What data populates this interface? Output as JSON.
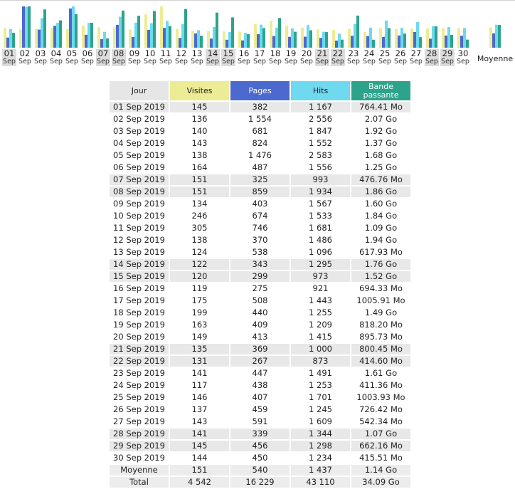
{
  "header": {
    "day_col": "Jour",
    "visits_col": "Visites",
    "pages_col": "Pages",
    "hits_col": "Hits",
    "bandwidth_col_line1": "Bande",
    "bandwidth_col_line2": "passante"
  },
  "colors": {
    "visits": "#ecec95",
    "pages": "#4b69cf",
    "hits": "#6ed9ef",
    "bandwidth": "#2ea38b",
    "weekend_bg": "#e8e8e8"
  },
  "average_label": "Moyenne",
  "chart_data": {
    "type": "bar",
    "categories": [
      "01",
      "02",
      "03",
      "04",
      "05",
      "06",
      "07",
      "08",
      "09",
      "10",
      "11",
      "12",
      "13",
      "14",
      "15",
      "16",
      "17",
      "18",
      "19",
      "20",
      "21",
      "22",
      "23",
      "24",
      "25",
      "26",
      "27",
      "28",
      "29",
      "30"
    ],
    "category_sublabel": "Sep",
    "weekend_days": [
      "01",
      "07",
      "08",
      "14",
      "15",
      "21",
      "22",
      "28",
      "29"
    ],
    "series": [
      {
        "name": "Visites",
        "values": [
          145,
          136,
          140,
          143,
          138,
          164,
          151,
          151,
          134,
          246,
          305,
          138,
          124,
          122,
          120,
          119,
          175,
          199,
          163,
          149,
          135,
          131,
          141,
          117,
          146,
          137,
          143,
          141,
          145,
          144
        ]
      },
      {
        "name": "Pages",
        "values": [
          382,
          1554,
          681,
          824,
          1476,
          487,
          325,
          859,
          403,
          674,
          746,
          370,
          538,
          343,
          299,
          275,
          508,
          440,
          409,
          413,
          369,
          267,
          447,
          438,
          407,
          459,
          591,
          339,
          456,
          450
        ]
      },
      {
        "name": "Hits",
        "values": [
          1167,
          2556,
          1847,
          1552,
          2583,
          1556,
          993,
          1934,
          1567,
          1533,
          1681,
          1486,
          1096,
          1295,
          973,
          921,
          1443,
          1255,
          1209,
          1415,
          1000,
          873,
          1491,
          1253,
          1701,
          1245,
          1609,
          1344,
          1298,
          1234
        ]
      },
      {
        "name": "Bande passante",
        "values": [
          764.41,
          2119.68,
          1966.08,
          1402.88,
          1720.32,
          1280,
          476.76,
          1904.64,
          1638.4,
          1884.16,
          1116.16,
          1986.56,
          617.93,
          1802.24,
          1556.48,
          694.33,
          1005.91,
          1525.76,
          818.2,
          895.73,
          800.45,
          414.6,
          1648.64,
          411.36,
          1003.93,
          726.42,
          542.34,
          1095.68,
          662.16,
          415.51
        ]
      }
    ],
    "average": {
      "visits": 151,
      "pages": 540,
      "hits": 1437,
      "bandwidth": 1167.36
    }
  },
  "rows": [
    {
      "day": "01 Sep 2019",
      "visits": "145",
      "pages": "382",
      "hits": "1 167",
      "bandwidth": "764.41 Mo",
      "weekend": true
    },
    {
      "day": "02 Sep 2019",
      "visits": "136",
      "pages": "1 554",
      "hits": "2 556",
      "bandwidth": "2.07 Go",
      "weekend": false
    },
    {
      "day": "03 Sep 2019",
      "visits": "140",
      "pages": "681",
      "hits": "1 847",
      "bandwidth": "1.92 Go",
      "weekend": false
    },
    {
      "day": "04 Sep 2019",
      "visits": "143",
      "pages": "824",
      "hits": "1 552",
      "bandwidth": "1.37 Go",
      "weekend": false
    },
    {
      "day": "05 Sep 2019",
      "visits": "138",
      "pages": "1 476",
      "hits": "2 583",
      "bandwidth": "1.68 Go",
      "weekend": false
    },
    {
      "day": "06 Sep 2019",
      "visits": "164",
      "pages": "487",
      "hits": "1 556",
      "bandwidth": "1.25 Go",
      "weekend": false
    },
    {
      "day": "07 Sep 2019",
      "visits": "151",
      "pages": "325",
      "hits": "993",
      "bandwidth": "476.76 Mo",
      "weekend": true
    },
    {
      "day": "08 Sep 2019",
      "visits": "151",
      "pages": "859",
      "hits": "1 934",
      "bandwidth": "1.86 Go",
      "weekend": true
    },
    {
      "day": "09 Sep 2019",
      "visits": "134",
      "pages": "403",
      "hits": "1 567",
      "bandwidth": "1.60 Go",
      "weekend": false
    },
    {
      "day": "10 Sep 2019",
      "visits": "246",
      "pages": "674",
      "hits": "1 533",
      "bandwidth": "1.84 Go",
      "weekend": false
    },
    {
      "day": "11 Sep 2019",
      "visits": "305",
      "pages": "746",
      "hits": "1 681",
      "bandwidth": "1.09 Go",
      "weekend": false
    },
    {
      "day": "12 Sep 2019",
      "visits": "138",
      "pages": "370",
      "hits": "1 486",
      "bandwidth": "1.94 Go",
      "weekend": false
    },
    {
      "day": "13 Sep 2019",
      "visits": "124",
      "pages": "538",
      "hits": "1 096",
      "bandwidth": "617.93 Mo",
      "weekend": false
    },
    {
      "day": "14 Sep 2019",
      "visits": "122",
      "pages": "343",
      "hits": "1 295",
      "bandwidth": "1.76 Go",
      "weekend": true
    },
    {
      "day": "15 Sep 2019",
      "visits": "120",
      "pages": "299",
      "hits": "973",
      "bandwidth": "1.52 Go",
      "weekend": true
    },
    {
      "day": "16 Sep 2019",
      "visits": "119",
      "pages": "275",
      "hits": "921",
      "bandwidth": "694.33 Mo",
      "weekend": false
    },
    {
      "day": "17 Sep 2019",
      "visits": "175",
      "pages": "508",
      "hits": "1 443",
      "bandwidth": "1005.91 Mo",
      "weekend": false
    },
    {
      "day": "18 Sep 2019",
      "visits": "199",
      "pages": "440",
      "hits": "1 255",
      "bandwidth": "1.49 Go",
      "weekend": false
    },
    {
      "day": "19 Sep 2019",
      "visits": "163",
      "pages": "409",
      "hits": "1 209",
      "bandwidth": "818.20 Mo",
      "weekend": false
    },
    {
      "day": "20 Sep 2019",
      "visits": "149",
      "pages": "413",
      "hits": "1 415",
      "bandwidth": "895.73 Mo",
      "weekend": false
    },
    {
      "day": "21 Sep 2019",
      "visits": "135",
      "pages": "369",
      "hits": "1 000",
      "bandwidth": "800.45 Mo",
      "weekend": true
    },
    {
      "day": "22 Sep 2019",
      "visits": "131",
      "pages": "267",
      "hits": "873",
      "bandwidth": "414.60 Mo",
      "weekend": true
    },
    {
      "day": "23 Sep 2019",
      "visits": "141",
      "pages": "447",
      "hits": "1 491",
      "bandwidth": "1.61 Go",
      "weekend": false
    },
    {
      "day": "24 Sep 2019",
      "visits": "117",
      "pages": "438",
      "hits": "1 253",
      "bandwidth": "411.36 Mo",
      "weekend": false
    },
    {
      "day": "25 Sep 2019",
      "visits": "146",
      "pages": "407",
      "hits": "1 701",
      "bandwidth": "1003.93 Mo",
      "weekend": false
    },
    {
      "day": "26 Sep 2019",
      "visits": "137",
      "pages": "459",
      "hits": "1 245",
      "bandwidth": "726.42 Mo",
      "weekend": false
    },
    {
      "day": "27 Sep 2019",
      "visits": "143",
      "pages": "591",
      "hits": "1 609",
      "bandwidth": "542.34 Mo",
      "weekend": false
    },
    {
      "day": "28 Sep 2019",
      "visits": "141",
      "pages": "339",
      "hits": "1 344",
      "bandwidth": "1.07 Go",
      "weekend": true
    },
    {
      "day": "29 Sep 2019",
      "visits": "145",
      "pages": "456",
      "hits": "1 298",
      "bandwidth": "662.16 Mo",
      "weekend": true
    },
    {
      "day": "30 Sep 2019",
      "visits": "144",
      "pages": "450",
      "hits": "1 234",
      "bandwidth": "415.51 Mo",
      "weekend": false
    }
  ],
  "summary": [
    {
      "day": "Moyenne",
      "visits": "151",
      "pages": "540",
      "hits": "1 437",
      "bandwidth": "1.14 Go"
    },
    {
      "day": "Total",
      "visits": "4 542",
      "pages": "16 229",
      "hits": "43 110",
      "bandwidth": "34.09 Go"
    }
  ]
}
